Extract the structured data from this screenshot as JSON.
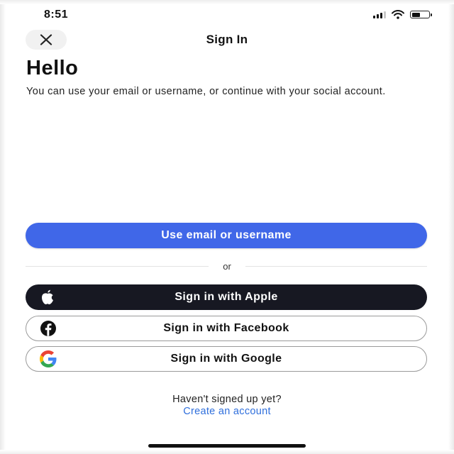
{
  "status_bar": {
    "time": "8:51",
    "icons": [
      "cellular-signal-icon",
      "wifi-icon",
      "battery-icon"
    ],
    "battery_level": 0.55
  },
  "header": {
    "close_icon": "close-icon",
    "title": "Sign In"
  },
  "main": {
    "heading": "Hello",
    "subtitle": "You can use your email or username, or continue with your social account."
  },
  "buttons": {
    "email": "Use email or username",
    "apple": "Sign in with Apple",
    "facebook": "Sign in with Facebook",
    "google": "Sign in with Google"
  },
  "divider": {
    "text": "or"
  },
  "footer": {
    "prompt": "Haven't signed up yet?",
    "link": "Create an account"
  },
  "colors": {
    "primary": "#4067e8",
    "apple_button": "#171822",
    "link": "#2f6fdc"
  }
}
